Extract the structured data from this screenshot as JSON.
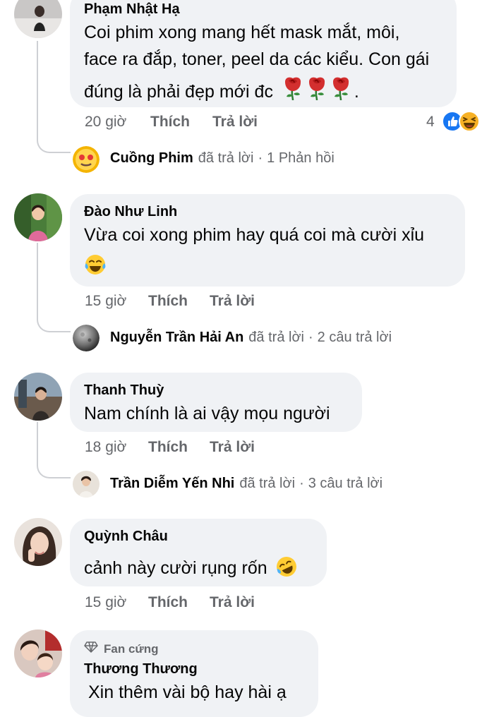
{
  "colors": {
    "bubble": "#f0f2f5",
    "secondary": "#65676b",
    "like": "#1877f2",
    "haha": "#f7b125"
  },
  "comments": [
    {
      "author": "Phạm Nhật Hạ",
      "lines": [
        "Coi phim xong mang hết mask mắt, môi,",
        "face ra đắp, toner, peel da các kiểu. Con gái",
        "đúng là phải đẹp mới đc"
      ],
      "trailing": ".",
      "emoji": [
        "rose-icon",
        "rose-icon",
        "rose-icon"
      ],
      "time": "20 giờ",
      "like": "Thích",
      "reply": "Trả lời",
      "reaction_count": "4",
      "reactions": [
        "like-icon",
        "haha-icon"
      ],
      "reply_summary": {
        "name": "Cuồng Phim",
        "action": "đã trả lời",
        "dot": "·",
        "count": "1 Phản hồi"
      }
    },
    {
      "author": "Đào Như Linh",
      "lines": [
        "Vừa coi xong phim hay quá coi mà cười xỉu"
      ],
      "emoji": [
        "tears-of-joy-icon"
      ],
      "time": "15 giờ",
      "like": "Thích",
      "reply": "Trả lời",
      "reply_summary": {
        "name": "Nguyễn Trần Hải An",
        "action": "đã trả lời",
        "dot": "·",
        "count": "2 câu trả lời"
      }
    },
    {
      "author": "Thanh Thuỳ",
      "lines": [
        "Nam chính là ai vậy mọu người"
      ],
      "time": "18 giờ",
      "like": "Thích",
      "reply": "Trả lời",
      "reply_summary": {
        "name": "Trần Diễm Yến Nhi",
        "action": "đã trả lời",
        "dot": "·",
        "count": "3 câu trả lời"
      }
    },
    {
      "author": "Quỳnh Châu",
      "lines": [
        "cảnh này cười rụng rốn"
      ],
      "emoji": [
        "rolling-laughing-icon"
      ],
      "time": "15 giờ",
      "like": "Thích",
      "reply": "Trả lời"
    },
    {
      "badge": "Fan cứng",
      "author": "Thương Thương",
      "lines": [
        "Xin thêm vài bộ hay hài ạ"
      ]
    }
  ]
}
